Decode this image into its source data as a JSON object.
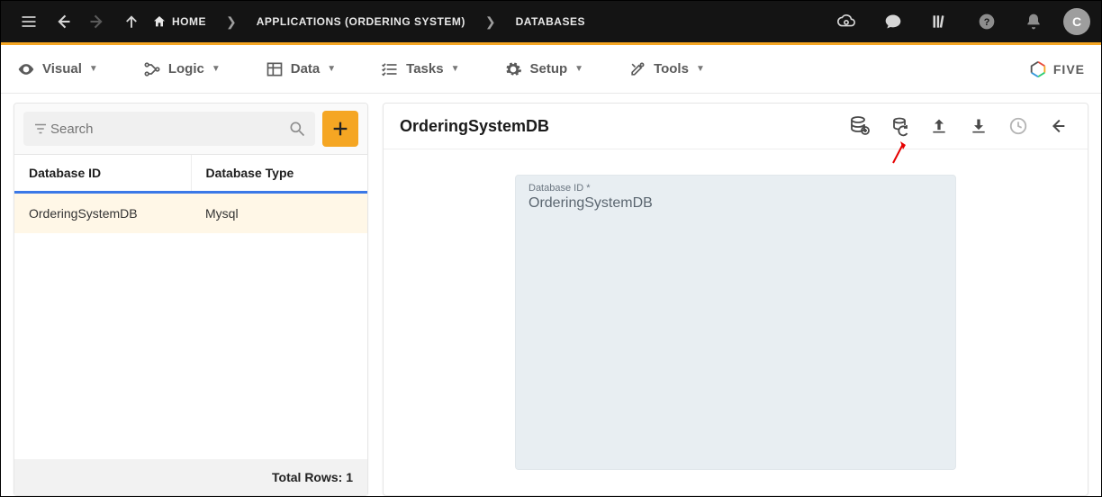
{
  "topbar": {
    "breadcrumbs": {
      "home": "HOME",
      "apps": "APPLICATIONS (ORDERING SYSTEM)",
      "dbs": "DATABASES"
    },
    "avatar_initial": "C"
  },
  "menubar": {
    "visual": "Visual",
    "logic": "Logic",
    "data": "Data",
    "tasks": "Tasks",
    "setup": "Setup",
    "tools": "Tools",
    "brand": "FIVE"
  },
  "left": {
    "search_placeholder": "Search",
    "columns": {
      "id": "Database ID",
      "type": "Database Type"
    },
    "rows": [
      {
        "id": "OrderingSystemDB",
        "type": "Mysql"
      }
    ],
    "footer": "Total Rows: 1"
  },
  "right": {
    "title": "OrderingSystemDB",
    "field_label": "Database ID *",
    "field_value": "OrderingSystemDB"
  }
}
